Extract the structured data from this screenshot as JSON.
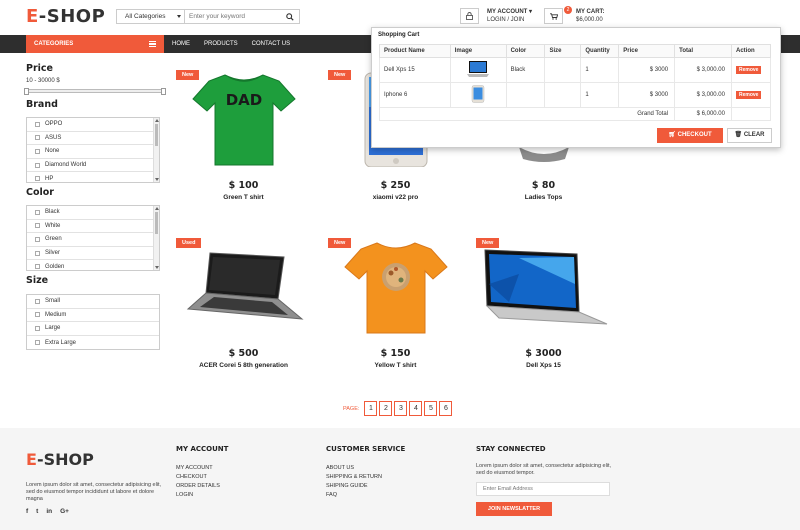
{
  "header": {
    "logo_e": "E",
    "logo_rest": "-SHOP",
    "search": {
      "category": "All Categories",
      "placeholder": "Enter your keyword"
    },
    "account": {
      "title": "MY ACCOUNT",
      "sub": "LOGIN / JOIN"
    },
    "cart": {
      "count": "2",
      "title": "MY CART:",
      "amount": "$6,000.00"
    }
  },
  "nav": {
    "categories_label": "CATEGORIES",
    "links": [
      "HOME",
      "PRODUCTS",
      "CONTACT US"
    ]
  },
  "sidebar": {
    "price_title": "Price",
    "price_range": "10 - 30000 $",
    "brand_title": "Brand",
    "brands": [
      "OPPO",
      "ASUS",
      "None",
      "Diamond World",
      "HP"
    ],
    "color_title": "Color",
    "colors": [
      "Black",
      "White",
      "Green",
      "Silver",
      "Golden"
    ],
    "size_title": "Size",
    "sizes": [
      "Small",
      "Medium",
      "Large",
      "Extra Large"
    ]
  },
  "products": [
    {
      "badge": "New",
      "price": "$ 100",
      "name": "Green T shirt",
      "image": "green-tshirt",
      "image_text": "DAD"
    },
    {
      "badge": "New",
      "price": "$ 250",
      "name": "xiaomi v22 pro",
      "image": "phone"
    },
    {
      "badge": "",
      "price": "$ 80",
      "name": "Ladies Tops",
      "image": "gray-top"
    },
    {
      "badge": "Used",
      "price": "$ 500",
      "name": "ACER Corei 5 8th generation",
      "image": "laptop-acer"
    },
    {
      "badge": "New",
      "price": "$ 150",
      "name": "Yellow T shirt",
      "image": "orange-tshirt"
    },
    {
      "badge": "New",
      "price": "$ 3000",
      "name": "Dell Xps 15",
      "image": "laptop-dell"
    }
  ],
  "pagination": {
    "label": "PAGE:",
    "pages": [
      "1",
      "2",
      "3",
      "4",
      "5",
      "6"
    ],
    "current": "1"
  },
  "cart_dropdown": {
    "title": "Shopping Cart",
    "columns": [
      "Product Name",
      "Image",
      "Color",
      "Size",
      "Quantity",
      "Price",
      "Total",
      "Action"
    ],
    "rows": [
      {
        "name": "Dell Xps 15",
        "image": "laptop-thumb",
        "color": "Black",
        "size": "",
        "qty": "1",
        "price": "$ 3000",
        "total": "$ 3,000.00",
        "action": "Remove"
      },
      {
        "name": "Iphone 6",
        "image": "phone-thumb",
        "color": "",
        "size": "",
        "qty": "1",
        "price": "$ 3000",
        "total": "$ 3,000.00",
        "action": "Remove"
      }
    ],
    "grand_total_label": "Grand Total",
    "grand_total": "$ 6,000.00",
    "checkout_label": "CHECKOUT",
    "clear_label": "CLEAR"
  },
  "footer": {
    "logo_e": "E",
    "logo_rest": "-SHOP",
    "desc": "Lorem ipsum dolor sit amet, consectetur adipisicing elit, sed do eiusmod tempor incididunt ut labore et dolore magna",
    "social": [
      "f",
      "t",
      "in",
      "G+"
    ],
    "my_account_title": "MY ACCOUNT",
    "my_account_links": [
      "MY ACCOUNT",
      "CHECKOUT",
      "ORDER DETAILS",
      "LOGIN"
    ],
    "customer_title": "CUSTOMER SERVICE",
    "customer_links": [
      "ABOUT US",
      "SHIPPING & RETURN",
      "SHIPING GUIDE",
      "FAQ"
    ],
    "stay_title": "STAY CONNECTED",
    "stay_desc": "Lorem ipsum dolor sit amet, consectetur adipisicing elit, sed do eiusmod tempor.",
    "email_placeholder": "Enter Email Address",
    "newsletter_label": "JOIN NEWSLATTER"
  },
  "colors": {
    "accent": "#f05a3a",
    "nav_bg": "#2e2e2e",
    "footer_bg": "#f5f5f5"
  }
}
